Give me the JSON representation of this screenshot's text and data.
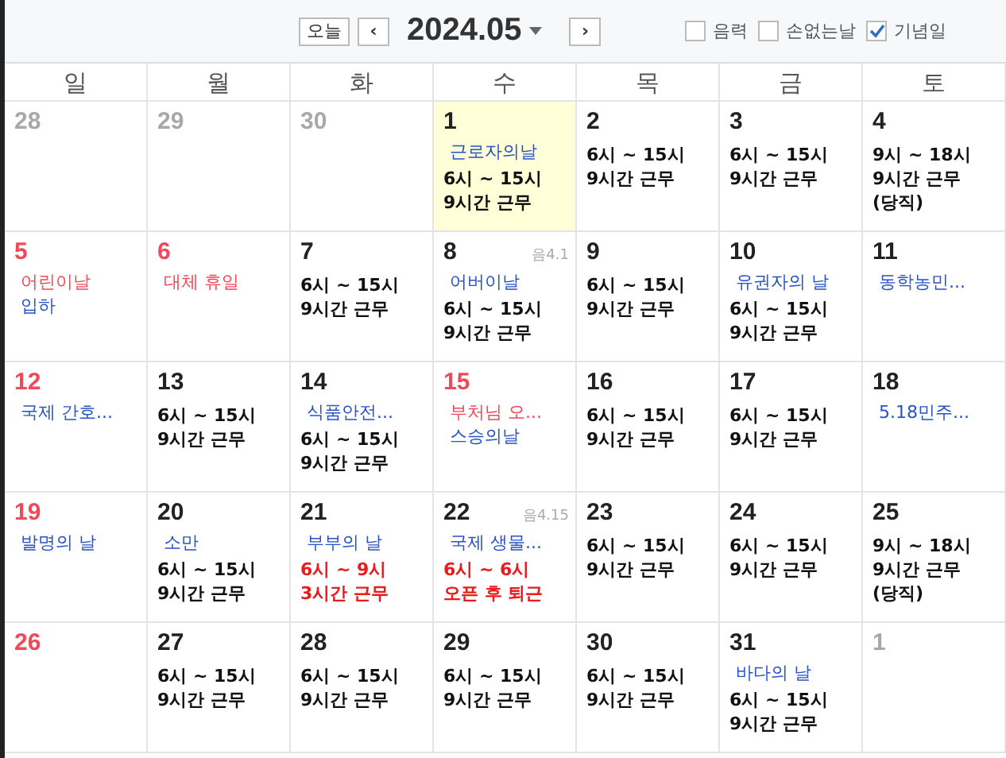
{
  "toolbar": {
    "today_button": "오늘",
    "prev_button": "‹",
    "next_button": "›",
    "title": "2024.05",
    "options": [
      {
        "label": "음력",
        "checked": false
      },
      {
        "label": "손없는날",
        "checked": false
      },
      {
        "label": "기념일",
        "checked": true
      }
    ]
  },
  "weekdays": [
    {
      "label": "일"
    },
    {
      "label": "월"
    },
    {
      "label": "화"
    },
    {
      "label": "수"
    },
    {
      "label": "목"
    },
    {
      "label": "금"
    },
    {
      "label": "토"
    }
  ],
  "weeks": [
    [
      {
        "day": "28",
        "kind": "other"
      },
      {
        "day": "29",
        "kind": "other"
      },
      {
        "day": "30",
        "kind": "other"
      },
      {
        "day": "1",
        "kind": "normal",
        "today": true,
        "events": [
          {
            "text": "근로자의날",
            "color": "#2a52c8"
          }
        ],
        "memo": [
          "6시 ~ 15시",
          "9시간 근무"
        ]
      },
      {
        "day": "2",
        "kind": "normal",
        "memo": [
          "6시 ~ 15시",
          "9시간 근무"
        ]
      },
      {
        "day": "3",
        "kind": "normal",
        "memo": [
          "6시 ~ 15시",
          "9시간 근무"
        ]
      },
      {
        "day": "4",
        "kind": "normal",
        "memo": [
          "9시 ~ 18시",
          "9시간 근무",
          "(당직)"
        ]
      }
    ],
    [
      {
        "day": "5",
        "kind": "holiday",
        "events": [
          {
            "text": "어린이날",
            "color": "#f04a5a"
          },
          {
            "text": "입하",
            "color": "#2a52c8"
          }
        ]
      },
      {
        "day": "6",
        "kind": "holiday",
        "events": [
          {
            "text": "대체 휴일",
            "color": "#f04a5a"
          }
        ]
      },
      {
        "day": "7",
        "kind": "normal",
        "memo": [
          "6시 ~ 15시",
          "9시간 근무"
        ]
      },
      {
        "day": "8",
        "kind": "normal",
        "lunar": "음4.1",
        "events": [
          {
            "text": "어버이날",
            "color": "#2a52c8"
          }
        ],
        "memo": [
          "6시 ~ 15시",
          "9시간 근무"
        ]
      },
      {
        "day": "9",
        "kind": "normal",
        "memo": [
          "6시 ~ 15시",
          "9시간 근무"
        ]
      },
      {
        "day": "10",
        "kind": "normal",
        "events": [
          {
            "text": "유권자의 날",
            "color": "#2a52c8"
          }
        ],
        "memo": [
          "6시 ~ 15시",
          "9시간 근무"
        ]
      },
      {
        "day": "11",
        "kind": "normal",
        "events": [
          {
            "text": "동학농민...",
            "color": "#2a52c8"
          }
        ]
      }
    ],
    [
      {
        "day": "12",
        "kind": "holiday",
        "events": [
          {
            "text": "국제 간호...",
            "color": "#2a52c8"
          }
        ]
      },
      {
        "day": "13",
        "kind": "normal",
        "memo": [
          "6시 ~ 15시",
          "9시간 근무"
        ]
      },
      {
        "day": "14",
        "kind": "normal",
        "events": [
          {
            "text": "식품안전...",
            "color": "#2a52c8"
          }
        ],
        "memo": [
          "6시 ~ 15시",
          "9시간 근무"
        ]
      },
      {
        "day": "15",
        "kind": "holiday",
        "events": [
          {
            "text": "부처님 오...",
            "color": "#f04a5a"
          },
          {
            "text": "스승의날",
            "color": "#2a52c8"
          }
        ]
      },
      {
        "day": "16",
        "kind": "normal",
        "memo": [
          "6시 ~ 15시",
          "9시간 근무"
        ]
      },
      {
        "day": "17",
        "kind": "normal",
        "memo": [
          "6시 ~ 15시",
          "9시간 근무"
        ]
      },
      {
        "day": "18",
        "kind": "normal",
        "events": [
          {
            "text": "5.18민주...",
            "color": "#2a52c8"
          }
        ]
      }
    ],
    [
      {
        "day": "19",
        "kind": "holiday",
        "events": [
          {
            "text": "발명의 날",
            "color": "#2a52c8"
          }
        ]
      },
      {
        "day": "20",
        "kind": "normal",
        "events": [
          {
            "text": "소만",
            "color": "#2a52c8"
          }
        ],
        "memo": [
          "6시 ~ 15시",
          "9시간 근무"
        ]
      },
      {
        "day": "21",
        "kind": "normal",
        "events": [
          {
            "text": "부부의 날",
            "color": "#2a52c8"
          }
        ],
        "memo": [
          "6시 ~ 9시",
          "3시간 근무"
        ],
        "memo_alert": true
      },
      {
        "day": "22",
        "kind": "normal",
        "lunar": "음4.15",
        "events": [
          {
            "text": "국제 생물...",
            "color": "#2a52c8"
          }
        ],
        "memo": [
          "6시 ~ 6시",
          "오픈 후 퇴근"
        ],
        "memo_alert": true
      },
      {
        "day": "23",
        "kind": "normal",
        "memo": [
          "6시 ~ 15시",
          "9시간 근무"
        ]
      },
      {
        "day": "24",
        "kind": "normal",
        "memo": [
          "6시 ~ 15시",
          "9시간 근무"
        ]
      },
      {
        "day": "25",
        "kind": "normal",
        "memo": [
          "9시 ~ 18시",
          "9시간 근무",
          "(당직)"
        ]
      }
    ],
    [
      {
        "day": "26",
        "kind": "holiday"
      },
      {
        "day": "27",
        "kind": "normal",
        "memo": [
          "6시 ~ 15시",
          "9시간 근무"
        ]
      },
      {
        "day": "28",
        "kind": "normal",
        "memo": [
          "6시 ~ 15시",
          "9시간 근무"
        ]
      },
      {
        "day": "29",
        "kind": "normal",
        "memo": [
          "6시 ~ 15시",
          "9시간 근무"
        ]
      },
      {
        "day": "30",
        "kind": "normal",
        "memo": [
          "6시 ~ 15시",
          "9시간 근무"
        ]
      },
      {
        "day": "31",
        "kind": "normal",
        "events": [
          {
            "text": "바다의 날",
            "color": "#2a52c8"
          }
        ],
        "memo": [
          "6시 ~ 15시",
          "9시간 근무"
        ]
      },
      {
        "day": "1",
        "kind": "other"
      }
    ]
  ]
}
